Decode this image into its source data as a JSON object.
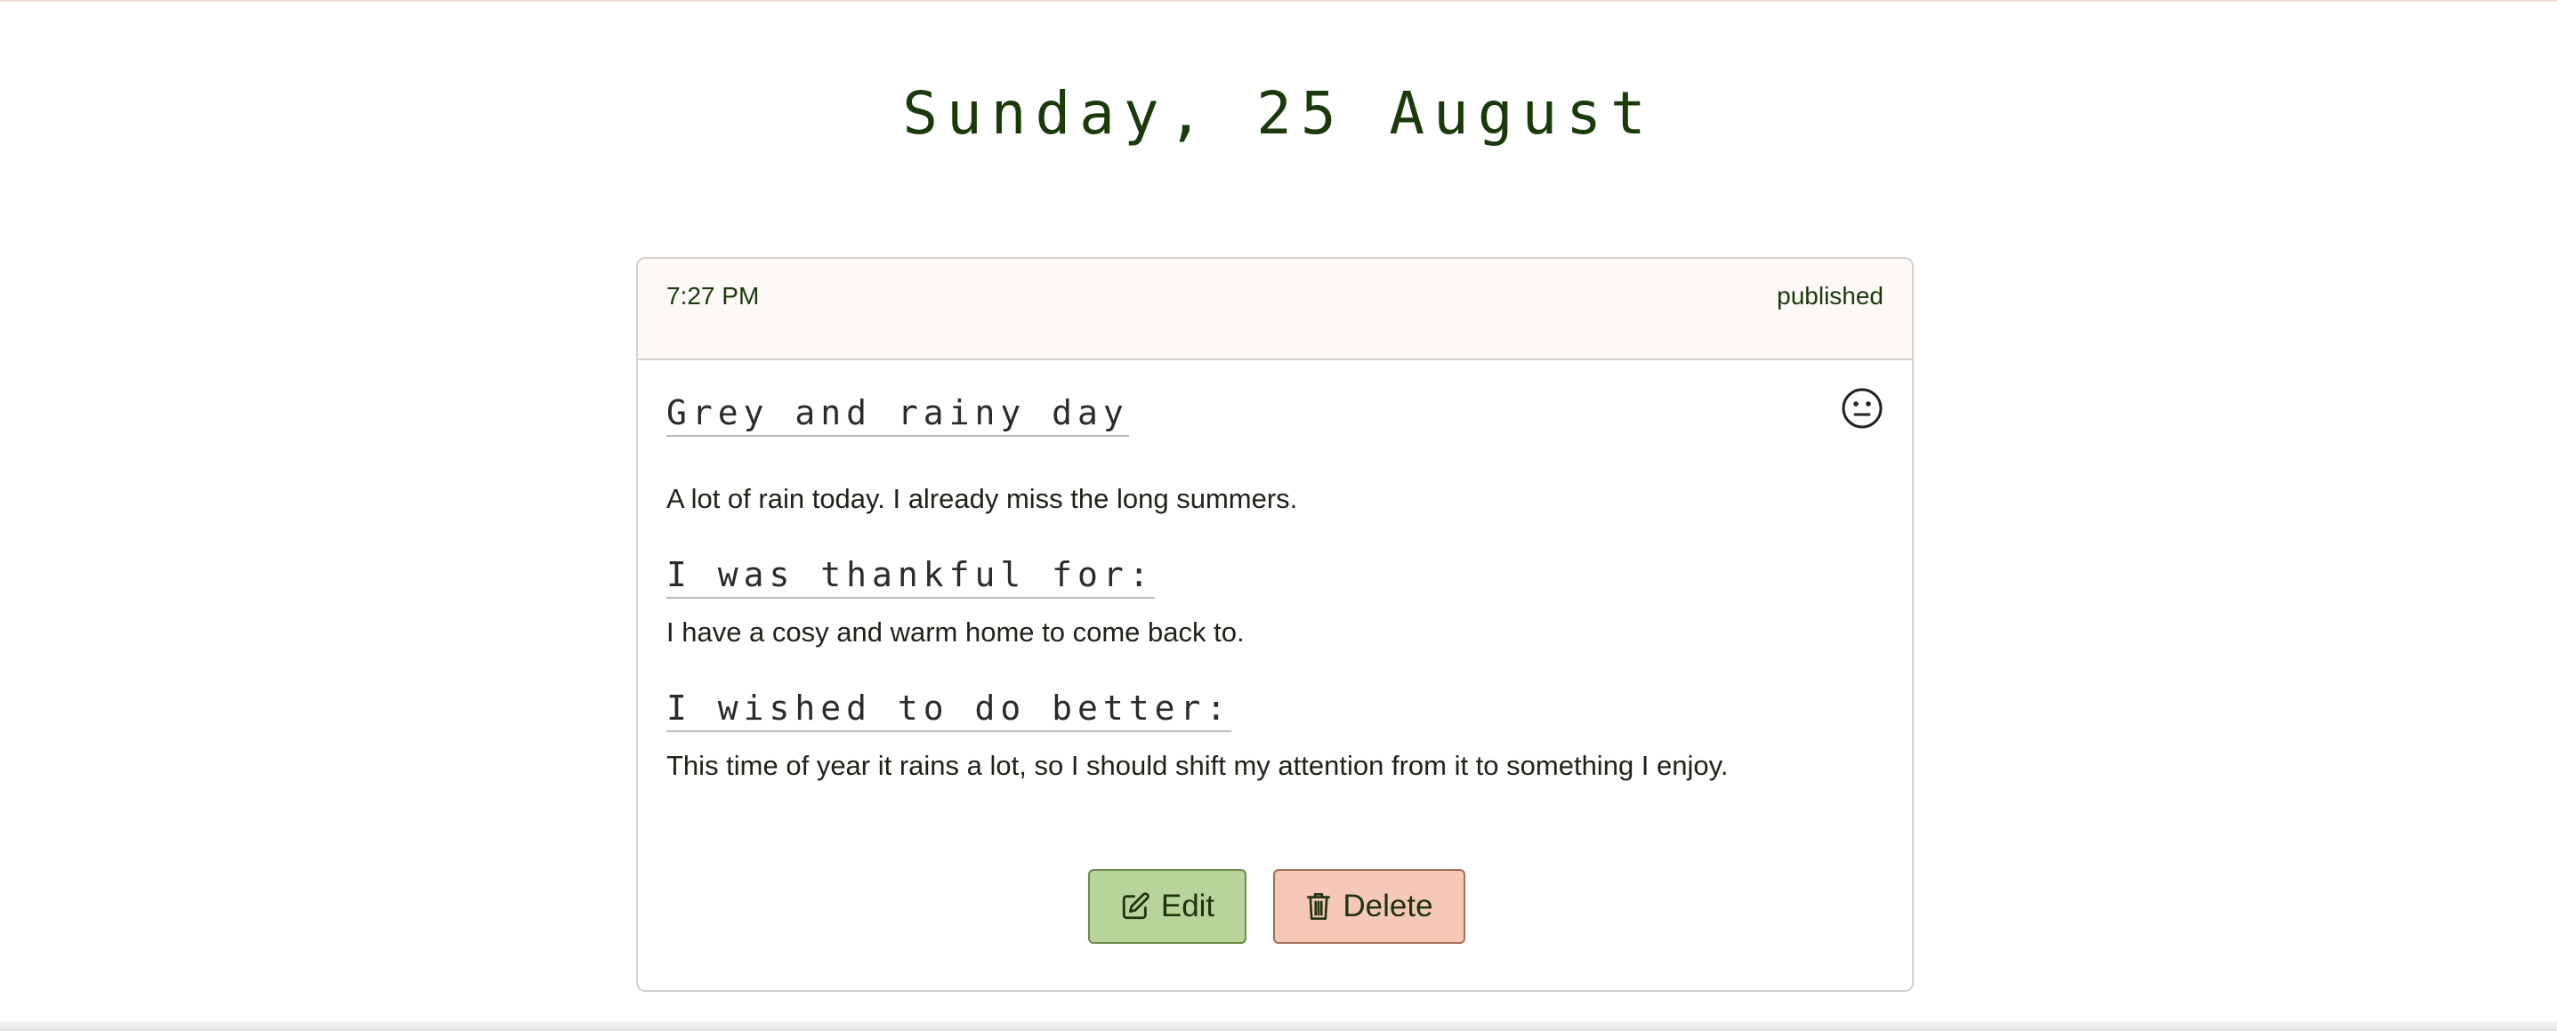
{
  "page": {
    "date_heading": "Sunday, 25 August"
  },
  "entry": {
    "time": "7:27 PM",
    "status": "published",
    "title": "Grey and rainy day",
    "mood_icon": "neutral-face-icon",
    "body": "A lot of rain today. I already miss the long summers.",
    "thankful_heading": "I was thankful for:",
    "thankful_text": "I have a cosy and warm home to come back to.",
    "better_heading": "I wished to do better:",
    "better_text": "This time of year it rains a lot, so I should shift my attention from it to something I enjoy."
  },
  "actions": {
    "edit_label": "Edit",
    "edit_icon": "pencil-square-icon",
    "delete_label": "Delete",
    "delete_icon": "trash-icon"
  },
  "colors": {
    "heading_green": "#1b3a0c",
    "header_bg": "#fdf9f6",
    "edit_bg": "#b9d49b",
    "delete_bg": "#f5c8b8"
  }
}
